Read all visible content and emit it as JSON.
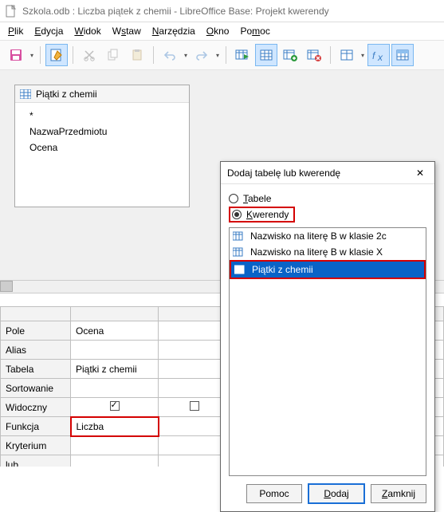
{
  "window": {
    "title": "Szkola.odb : Liczba piątek z chemii - LibreOffice Base: Projekt kwerendy"
  },
  "menu": {
    "file": "Plik",
    "edit": "Edycja",
    "view": "Widok",
    "insert": "Wstaw",
    "tools": "Narzędzia",
    "window": "Okno",
    "help": "Pomoc"
  },
  "tablewin": {
    "title": "Piątki z chemii",
    "star": "*",
    "f1": "NazwaPrzedmiotu",
    "f2": "Ocena"
  },
  "grid": {
    "rows": {
      "pole": "Pole",
      "alias": "Alias",
      "tabela": "Tabela",
      "sort": "Sortowanie",
      "widoczny": "Widoczny",
      "funkcja": "Funkcja",
      "kryt": "Kryterium",
      "lub": "lub"
    },
    "c1": {
      "pole": "Ocena",
      "tabela": "Piątki z chemii",
      "funkcja": "Liczba"
    }
  },
  "dialog": {
    "title": "Dodaj tabelę lub kwerendę",
    "opt_tables": "Tabele",
    "opt_queries": "Kwerendy",
    "items": {
      "i1": "Nazwisko na literę B w klasie 2c",
      "i2": "Nazwisko na literę B w klasie X",
      "i3": "Piątki z chemii"
    },
    "btn_help": "Pomoc",
    "btn_add": "Dodaj",
    "btn_close": "Zamknij"
  }
}
